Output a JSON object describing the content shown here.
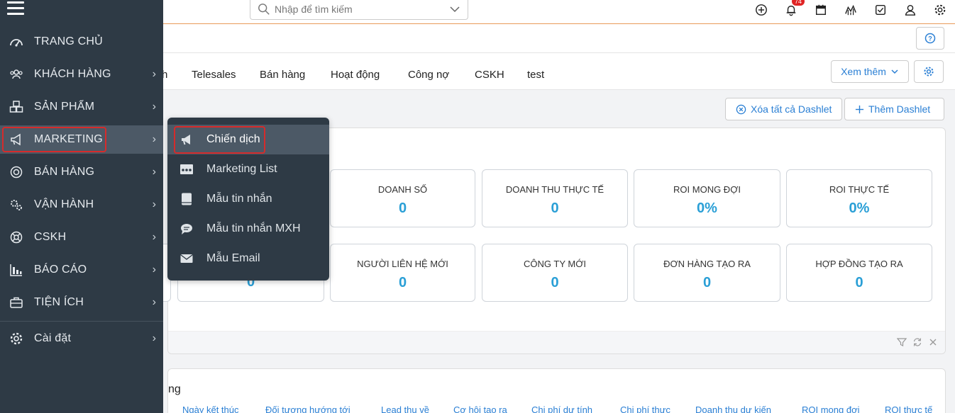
{
  "search": {
    "placeholder": "Nhập để tìm kiếm"
  },
  "notifications": {
    "count": "74"
  },
  "tabs": [
    "Telesales",
    "Bán hàng",
    "Hoạt động",
    "Công nợ",
    "CSKH",
    "test"
  ],
  "tab_partial": "h",
  "toolbar": {
    "more_label": "Xem thêm",
    "clear_label": "Xóa tất cả Dashlet",
    "add_label": "Thêm Dashlet"
  },
  "stats_row1": [
    {
      "label": "DOANH SỐ",
      "value": "0"
    },
    {
      "label": "DOANH THU THỰC TẾ",
      "value": "0"
    },
    {
      "label": "ROI MONG ĐỢI",
      "value": "0%"
    },
    {
      "label": "ROI THỰC TẾ",
      "value": "0%"
    }
  ],
  "stats_row2_partial_value": "0",
  "stats_row2": [
    {
      "label": "NGƯỜI LIÊN HỆ MỚI",
      "value": "0"
    },
    {
      "label": "CÔNG TY MỚI",
      "value": "0"
    },
    {
      "label": "ĐƠN HÀNG TẠO RA",
      "value": "0"
    },
    {
      "label": "HỢP ĐỒNG TẠO RA",
      "value": "0"
    }
  ],
  "panel2": {
    "title_partial": "ng",
    "columns": [
      "Ngày kết thúc",
      "Đối tượng hướng tới",
      "Lead thu về",
      "Cơ hội tạo ra",
      "Chi phí dự tính",
      "Chi phí thực",
      "Doanh thu dự kiến",
      "ROI mong đợi",
      "ROI thực tế"
    ]
  },
  "sidebar": {
    "items": [
      {
        "label": "TRANG CHỦ",
        "icon": "dashboard-icon"
      },
      {
        "label": "KHÁCH HÀNG",
        "icon": "users-icon"
      },
      {
        "label": "SẢN PHẨM",
        "icon": "boxes-icon"
      },
      {
        "label": "MARKETING",
        "icon": "megaphone-icon"
      },
      {
        "label": "BÁN HÀNG",
        "icon": "target-icon"
      },
      {
        "label": "VẬN HÀNH",
        "icon": "gears-icon"
      },
      {
        "label": "CSKH",
        "icon": "lifebuoy-icon"
      },
      {
        "label": "BÁO CÁO",
        "icon": "bar-chart-icon"
      },
      {
        "label": "TIỆN ÍCH",
        "icon": "briefcase-icon"
      },
      {
        "label": "Cài đặt",
        "icon": "gear-icon"
      }
    ]
  },
  "submenu": {
    "items": [
      {
        "label": "Chiến dịch",
        "icon": "megaphone-icon"
      },
      {
        "label": "Marketing List",
        "icon": "group-icon"
      },
      {
        "label": "Mẫu tin nhắn",
        "icon": "book-icon"
      },
      {
        "label": "Mẫu tin nhắn MXH",
        "icon": "chat-bubble-icon"
      },
      {
        "label": "Mẫu Email",
        "icon": "envelope-icon"
      }
    ]
  },
  "colors": {
    "sidebar_bg": "#2e3a45",
    "active_bg": "#4c5966",
    "accent": "#2a7fd4",
    "highlight": "#d62b2b",
    "stat_value": "#2a9fd6"
  }
}
